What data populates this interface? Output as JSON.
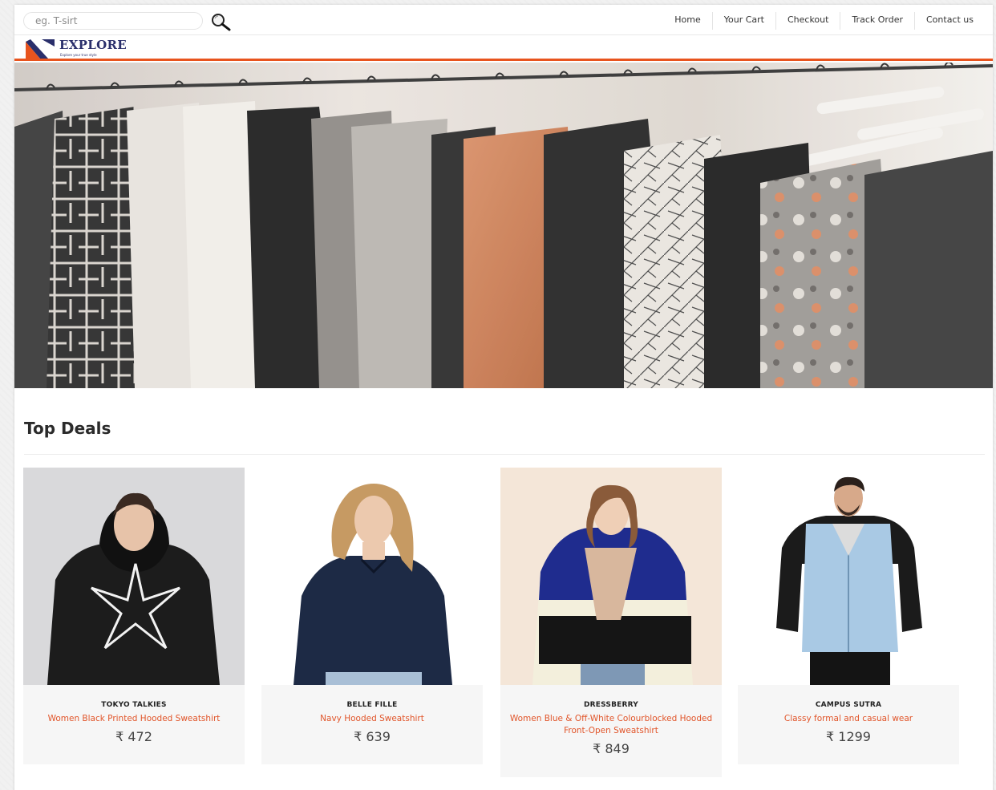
{
  "header": {
    "search": {
      "placeholder": "eg. T-sirt",
      "value": ""
    },
    "nav": [
      {
        "label": "Home"
      },
      {
        "label": "Your Cart"
      },
      {
        "label": "Checkout"
      },
      {
        "label": "Track Order"
      },
      {
        "label": "Contact us"
      }
    ]
  },
  "brand": {
    "name": "EXPLORE",
    "tagline": "Explore your true style",
    "accent_color": "#e8541e",
    "logo_color": "#2a2f6b"
  },
  "hero": {
    "image": "clothing-rack-photo"
  },
  "section": {
    "title": "Top Deals"
  },
  "products": [
    {
      "brand": "TOKYO TALKIES",
      "name": "Women Black Printed Hooded Sweatshirt",
      "price": "₹ 472",
      "image": "woman-black-star-hoodie"
    },
    {
      "brand": "BELLE FILLE",
      "name": "Navy Hooded Sweatshirt",
      "price": "₹ 639",
      "image": "woman-navy-sweatshirt"
    },
    {
      "brand": "DRESSBERRY",
      "name": "Women Blue & Off-White Colourblocked Hooded Front-Open Sweatshirt",
      "price": "₹ 849",
      "image": "woman-colourblock-hoodie"
    },
    {
      "brand": "CAMPUS SUTRA",
      "name": "Classy formal and casual wear",
      "price": "₹ 1299",
      "image": "man-denim-vest-hoodie"
    }
  ]
}
